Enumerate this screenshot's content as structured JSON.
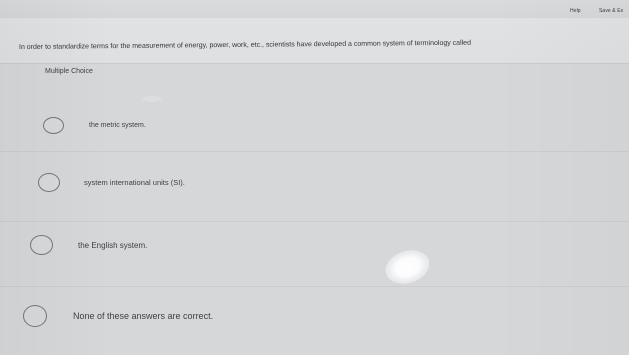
{
  "header": {
    "help_label": "Help",
    "save_label": "Save & Ex"
  },
  "question": {
    "prompt": "In order to standardize terms for the measurement of energy, power, work, etc., scientists have developed a common system of terminology called",
    "type_label": "Multiple Choice",
    "options": [
      {
        "label": "the metric system."
      },
      {
        "label": "system international units (SI)."
      },
      {
        "label": "the English system."
      },
      {
        "label": "None of these answers are correct."
      }
    ]
  }
}
